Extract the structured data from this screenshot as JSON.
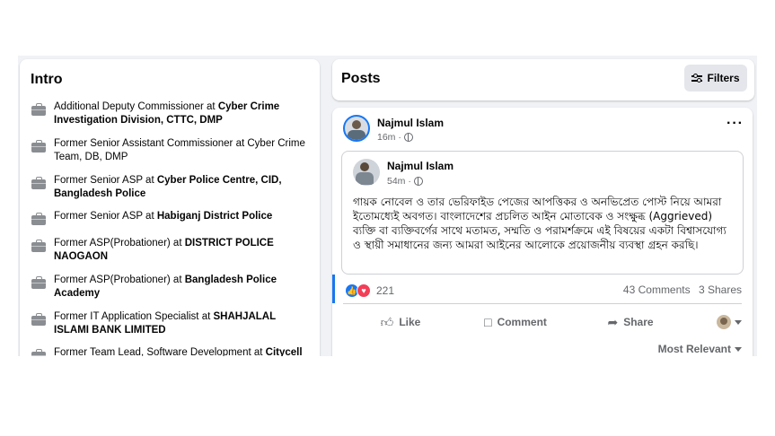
{
  "intro": {
    "title": "Intro",
    "items": [
      {
        "prefix": "Additional Deputy Commissioner at ",
        "bold": "Cyber Crime Investigation Division, CTTC, DMP",
        "suffix": ""
      },
      {
        "prefix": "Former Senior Assistant Commissioner at Cyber Crime Team, DB, DMP",
        "bold": "",
        "suffix": ""
      },
      {
        "prefix": "Former Senior ASP at ",
        "bold": "Cyber Police Centre, CID, Bangladesh Police",
        "suffix": ""
      },
      {
        "prefix": "Former Senior ASP at ",
        "bold": "Habiganj District Police",
        "suffix": ""
      },
      {
        "prefix": "Former ASP(Probationer) at ",
        "bold": "DISTRICT POLICE NAOGAON",
        "suffix": ""
      },
      {
        "prefix": "Former ASP(Probationer) at ",
        "bold": "Bangladesh Police Academy",
        "suffix": ""
      },
      {
        "prefix": "Former IT Application Specialist at ",
        "bold": "SHAHJALAL ISLAMI BANK LIMITED",
        "suffix": ""
      },
      {
        "prefix": "Former Team Lead, Software Development at ",
        "bold": "Citycell",
        "suffix": ""
      }
    ]
  },
  "posts_header": {
    "title": "Posts",
    "filters_label": "Filters"
  },
  "post": {
    "author": "Najmul Islam",
    "time": "16m ·",
    "shared": {
      "author": "Najmul Islam",
      "time": "54m ·",
      "text": "গায়ক নোবেল ও তার ভেরিফাইড পেজের আপত্তিকর ও অনভিপ্রেত পোস্ট নিয়ে আমরা ইতোমধ্যেই অবগত। বাংলাদেশের প্রচলিত আইন মোতাবেক ও সংক্ষুব্ধ (Aggrieved) ব্যক্তি বা ব্যক্তিবর্গের সাথে মতামত, সম্মতি ও পরামর্শক্রমে এই বিষয়ের একটা বিশ্বাসযোগ্য ও স্থায়ী সমাধানের জন্য আমরা আইনের আলোকে প্রয়োজনীয় ব্যবস্থা গ্রহন করছি।"
    },
    "reaction_count": "221",
    "comments": "43 Comments",
    "shares": "3 Shares",
    "actions": {
      "like": "Like",
      "comment": "Comment",
      "share": "Share"
    },
    "sort_label": "Most Relevant"
  },
  "colors": {
    "accent": "#1877f2",
    "love": "#f33e58",
    "muted": "#65676b",
    "background": "#f0f2f5"
  },
  "icons": [
    "briefcase-icon",
    "filters-icon",
    "globe-icon",
    "more-icon",
    "like-reaction-icon",
    "love-reaction-icon",
    "thumbs-up-icon",
    "comment-icon",
    "share-icon",
    "chevron-down-icon"
  ]
}
